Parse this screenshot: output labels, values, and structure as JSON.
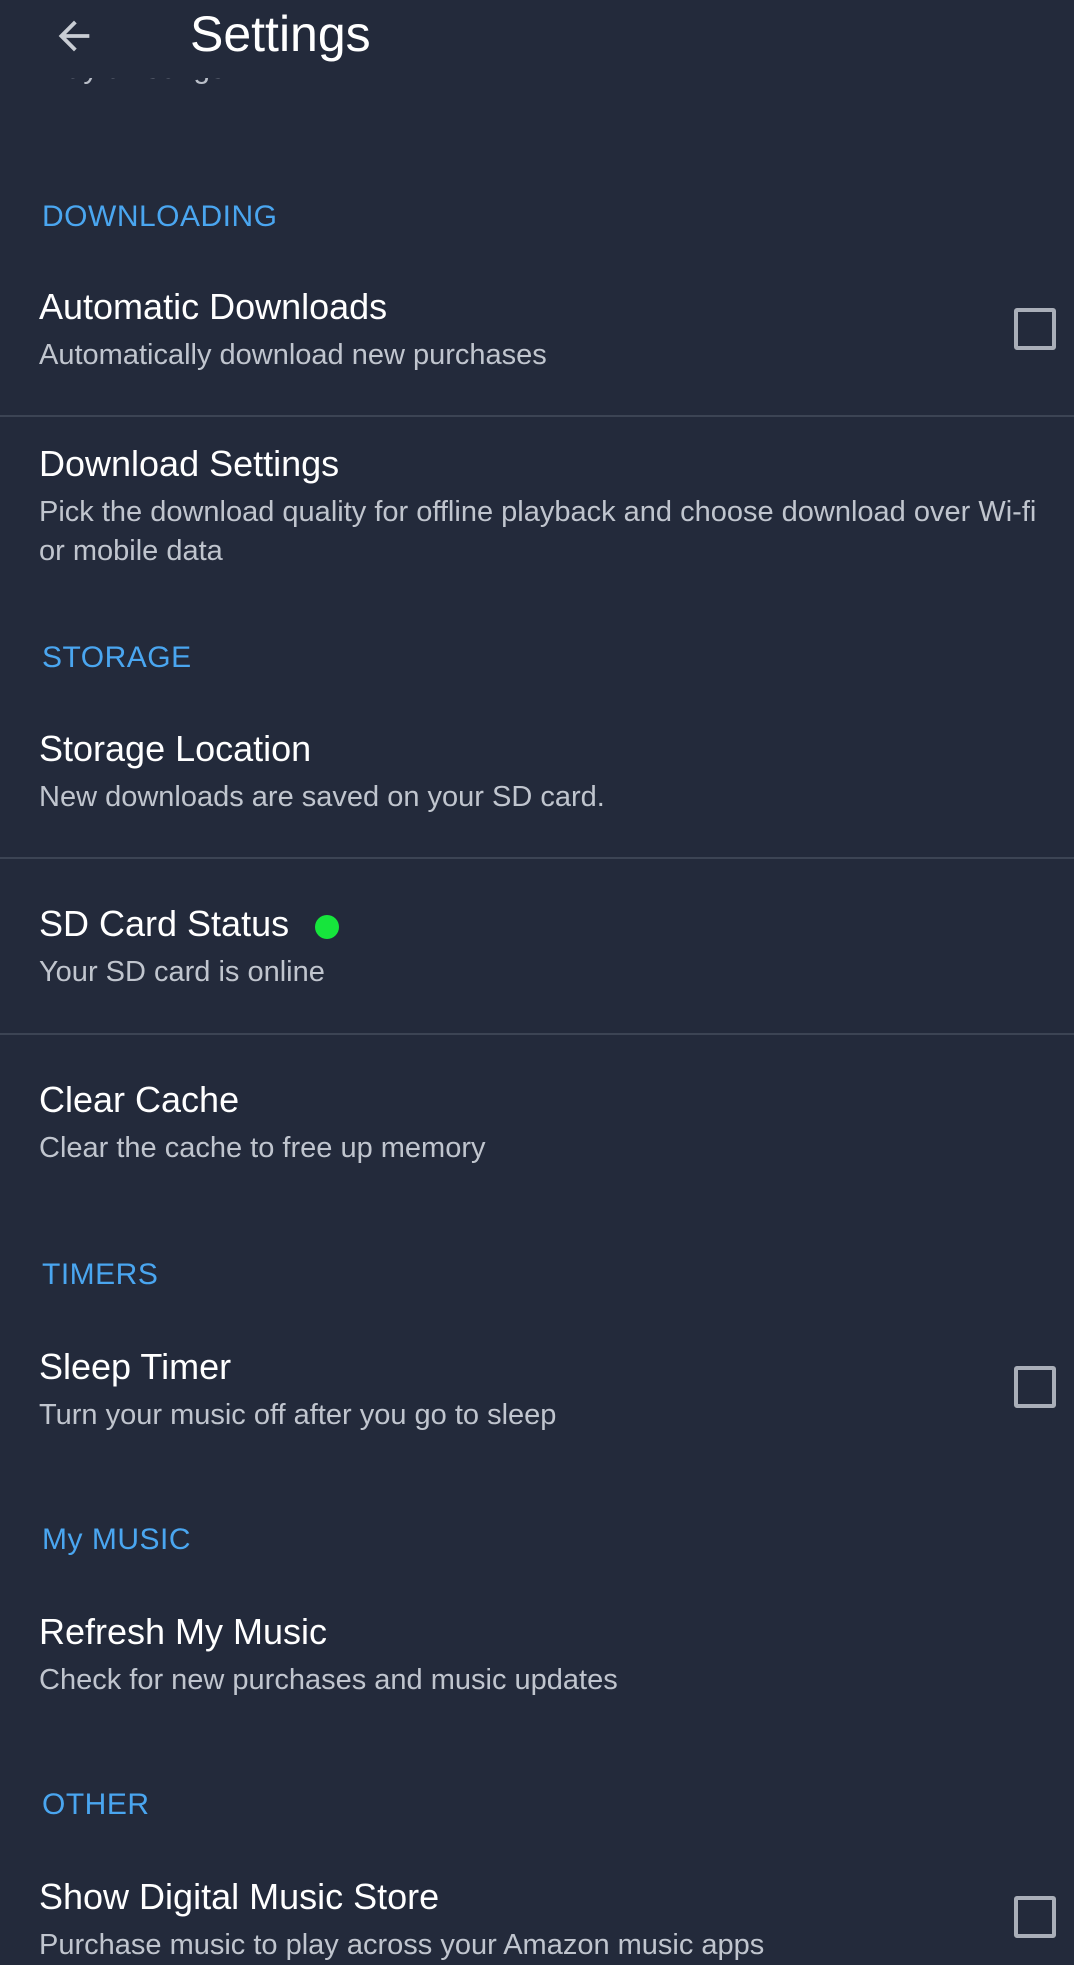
{
  "header": {
    "title": "Settings",
    "back_icon": "arrow-back-icon"
  },
  "scrolled_partial_text": "Play all songs",
  "sections": {
    "downloading": "DOWNLOADING",
    "storage": "STORAGE",
    "timers": "TIMERS",
    "my_music": "My MUSIC",
    "other": "OTHER"
  },
  "items": {
    "automatic_downloads": {
      "title": "Automatic Downloads",
      "subtitle": "Automatically download new purchases",
      "checked": false
    },
    "download_settings": {
      "title": "Download Settings",
      "subtitle": "Pick the download quality for offline playback and choose download over Wi-fi or mobile data"
    },
    "storage_location": {
      "title": "Storage Location",
      "subtitle": "New downloads are saved on your SD card."
    },
    "sd_card_status": {
      "title": "SD Card Status",
      "subtitle": "Your SD card is online",
      "status_color": "#16e53c"
    },
    "clear_cache": {
      "title": "Clear Cache",
      "subtitle": "Clear the cache to free up memory"
    },
    "sleep_timer": {
      "title": "Sleep Timer",
      "subtitle": "Turn your music off after you go to sleep",
      "checked": false
    },
    "refresh_my_music": {
      "title": "Refresh My Music",
      "subtitle": "Check for new purchases and music updates"
    },
    "show_digital_music_store": {
      "title": "Show Digital Music Store",
      "subtitle": "Purchase music to play across your Amazon music apps",
      "checked": false
    }
  },
  "colors": {
    "background": "#232a3b",
    "section_header": "#4aa6f0",
    "divider": "#3c4454",
    "title_text": "#ffffff",
    "subtitle_text": "#c0c5ce"
  }
}
